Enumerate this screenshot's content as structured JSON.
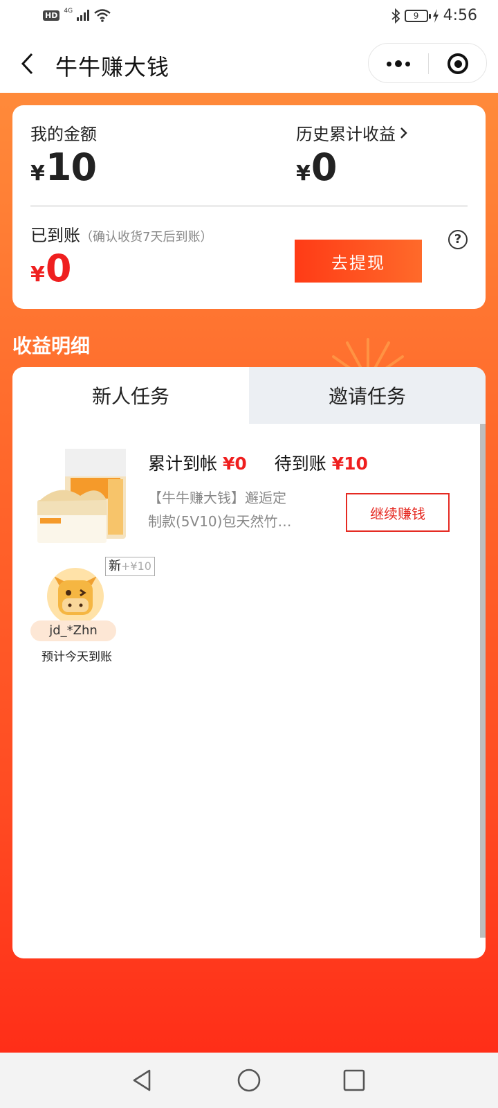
{
  "status_bar": {
    "hd": "HD",
    "network": "4G",
    "battery": "9",
    "time": "4:56"
  },
  "header": {
    "title": "牛牛赚大钱",
    "icons": [
      "back-arrow-icon",
      "more-dots-icon",
      "close-target-icon"
    ]
  },
  "summary": {
    "my_amount_label": "我的金额",
    "currency": "¥",
    "my_amount": "10",
    "history_label": "历史累计收益",
    "history_amount": "0",
    "arrived_label": "已到账",
    "arrived_hint": "（确认收货7天后到账）",
    "arrived_amount": "0",
    "withdraw_label": "去提现",
    "help_icon": "question-circle-icon"
  },
  "details": {
    "title": "收益明细",
    "tabs": [
      {
        "label": "新人任务",
        "active": true
      },
      {
        "label": "邀请任务",
        "active": false
      }
    ],
    "task": {
      "cumulative_label": "累计到帐",
      "cumulative_value": "¥0",
      "pending_label": "待到账",
      "pending_value": "¥10",
      "desc_line1": "【牛牛赚大钱】邂逅定",
      "desc_line2": "制款(5V10)包天然竹…",
      "button": "继续赚钱"
    },
    "invitee": {
      "badge_new": "新",
      "badge_reward": "+¥10",
      "username": "jd_*Zhn",
      "eta": "预计今天到账"
    }
  },
  "colors": {
    "accent_red": "#ef1f1f",
    "orange_top": "#ff8a3a",
    "orange_bottom": "#ff2e18"
  }
}
